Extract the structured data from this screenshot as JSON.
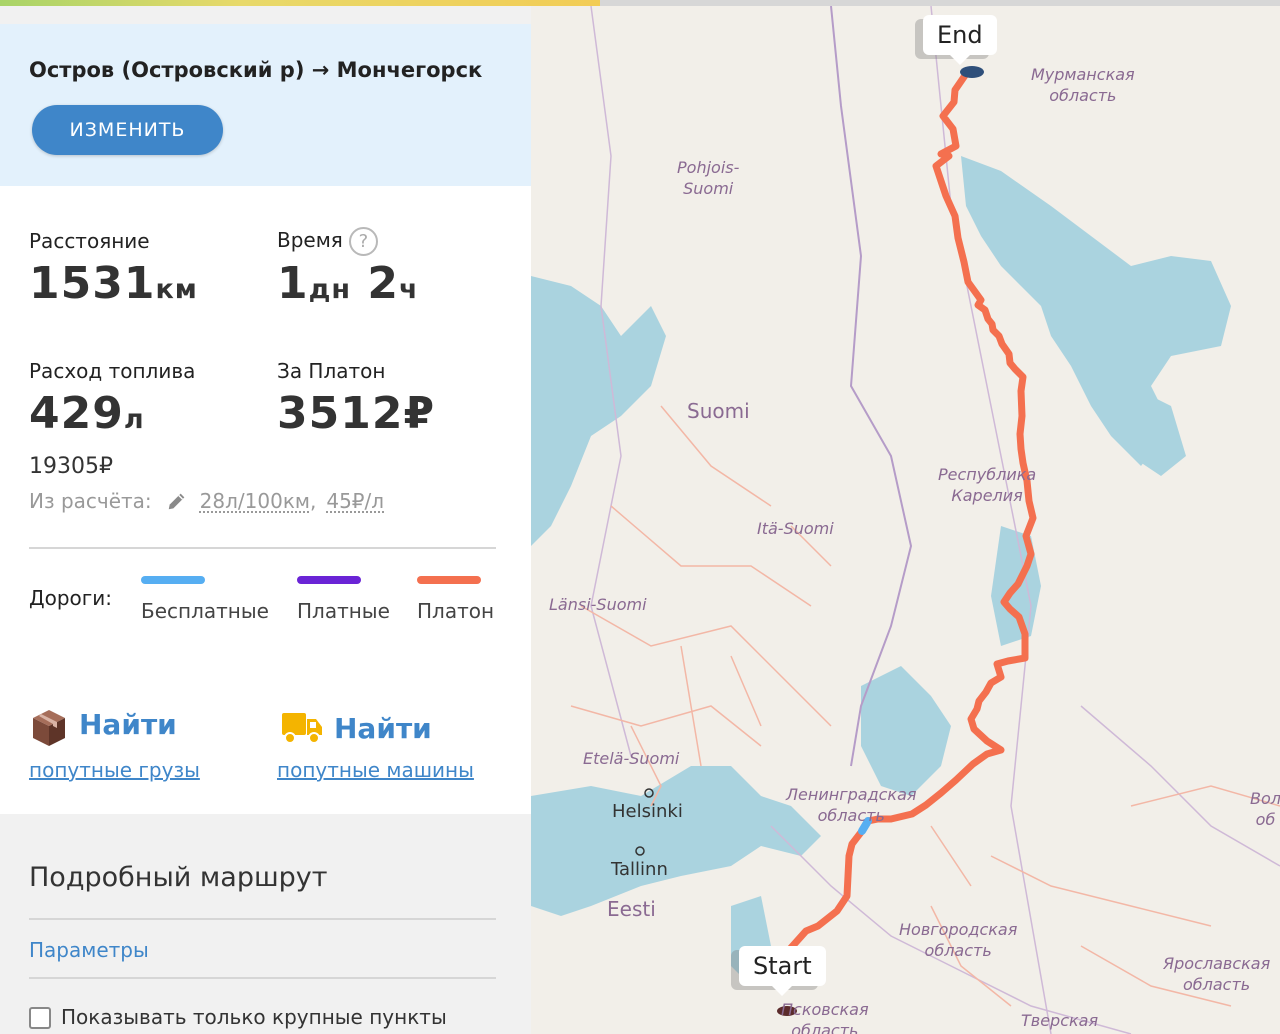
{
  "route": {
    "title": "Остров (Островский р) → Мончегорск",
    "edit_label": "ИЗМЕНИТЬ"
  },
  "stats": {
    "distance_label": "Расстояние",
    "distance_value": "1531",
    "distance_unit": "км",
    "time_label": "Время",
    "time_help": "?",
    "time_days": "1",
    "time_days_unit": "дн",
    "time_hours": "2",
    "time_hours_unit": "ч",
    "fuel_label": "Расход топлива",
    "fuel_value": "429",
    "fuel_unit": "л",
    "fuel_cost": "19305₽",
    "platon_label": "За Платон",
    "platon_value": "3512₽",
    "calc_label": "Из расчёта:",
    "calc_consumption": "28л/100км",
    "calc_separator": ",",
    "calc_price": "45₽/л"
  },
  "roads": {
    "label": "Дороги:",
    "items": [
      {
        "label": "Бесплатные",
        "color": "#56aef2"
      },
      {
        "label": "Платные",
        "color": "#6a24d6"
      },
      {
        "label": "Платон",
        "color": "#f4704f"
      }
    ]
  },
  "find": {
    "cargo_word": "Найти",
    "cargo_link": "попутные грузы",
    "cargo_icon": "box-icon",
    "trucks_word": "Найти",
    "trucks_link": "попутные машины",
    "trucks_icon": "truck-icon"
  },
  "details": {
    "title": "Подробный маршрут",
    "params_link": "Параметры",
    "checkbox_label": "Показывать только крупные пункты"
  },
  "map": {
    "end_label": "End",
    "start_label": "Start",
    "route_color": "#f4704f",
    "labels": {
      "murmansk": "Мурманская\nобласть",
      "pohjois": "Pohjois-\nSuomi",
      "suomi": "Suomi",
      "karelia": "Республика\nКарелия",
      "ita": "Itä-Suomi",
      "lansi": "Länsi-Suomi",
      "etela": "Etelä-Suomi",
      "helsinki": "Helsinki",
      "leningrad": "Ленинградская\nобласть",
      "tallinn": "Tallinn",
      "eesti": "Eesti",
      "novgorod": "Новгородская\nобласть",
      "pskov": "Псковская\nобласть",
      "yaroslavl": "Ярославская\nобласть",
      "tver": "Тверская",
      "volog": "Вол\nоб"
    }
  }
}
